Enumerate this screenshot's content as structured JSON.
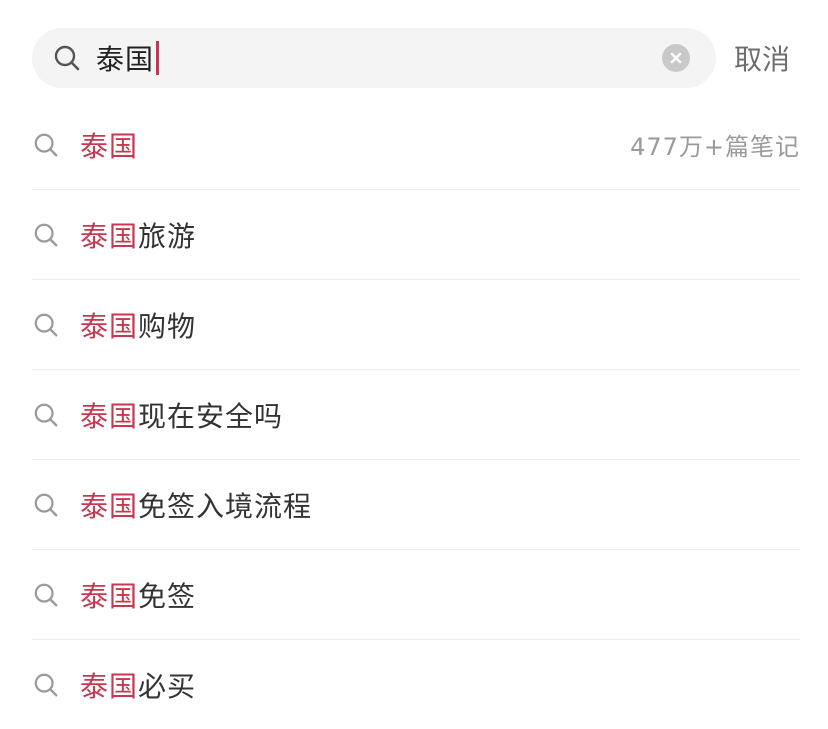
{
  "colors": {
    "accent": "#c8374f"
  },
  "search": {
    "icon": "search-icon",
    "query": "泰国",
    "clear_icon": "clear-icon",
    "cancel_label": "取消"
  },
  "suggestions": [
    {
      "highlight": "泰国",
      "rest": "",
      "count": "477万+篇笔记"
    },
    {
      "highlight": "泰国",
      "rest": "旅游"
    },
    {
      "highlight": "泰国",
      "rest": "购物"
    },
    {
      "highlight": "泰国",
      "rest": "现在安全吗"
    },
    {
      "highlight": "泰国",
      "rest": "免签入境流程"
    },
    {
      "highlight": "泰国",
      "rest": "免签"
    },
    {
      "highlight": "泰国",
      "rest": "必买"
    }
  ]
}
